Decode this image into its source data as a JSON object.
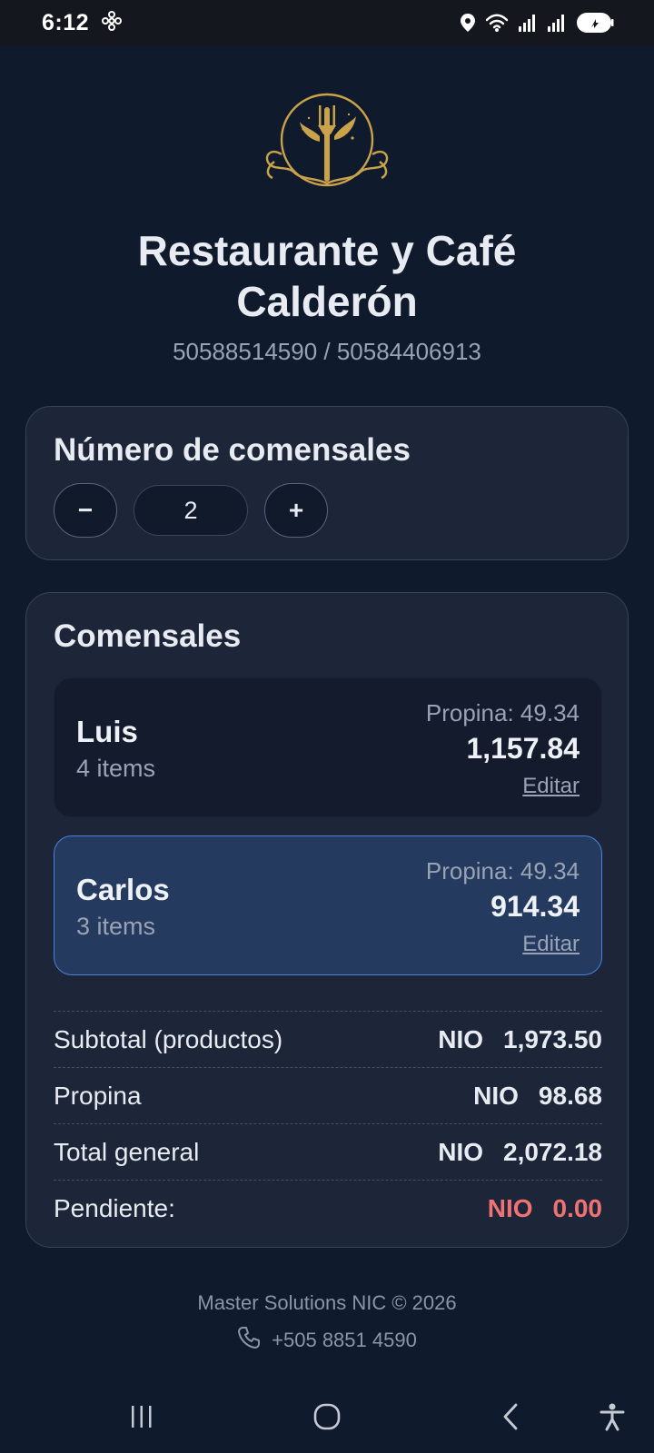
{
  "status_bar": {
    "time": "6:12",
    "icons": [
      "fan-icon",
      "location-icon",
      "wifi-icon",
      "signal-icon",
      "signal-icon-2",
      "battery-icon"
    ]
  },
  "header": {
    "logo": "restaurant-fork-leaf-logo",
    "title": "Restaurante y Café Calderón",
    "phones": "50588514590 / 50584406913"
  },
  "diners_count": {
    "title": "Número de comensales",
    "minus_label": "−",
    "value": "2",
    "plus_label": "+"
  },
  "diners": {
    "title": "Comensales",
    "list": [
      {
        "name": "Luis",
        "items": "4 items",
        "tip": "Propina: 49.34",
        "total": "1,157.84",
        "edit": "Editar"
      },
      {
        "name": "Carlos",
        "items": "3 items",
        "tip": "Propina: 49.34",
        "total": "914.34",
        "edit": "Editar"
      }
    ]
  },
  "summary": {
    "subtotal_label": "Subtotal (productos)",
    "subtotal_currency": "NIO",
    "subtotal_value": "1,973.50",
    "tip_label": "Propina",
    "tip_currency": "NIO",
    "tip_value": "98.68",
    "total_label": "Total general",
    "total_currency": "NIO",
    "total_value": "2,072.18",
    "pending_label": "Pendiente:",
    "pending_currency": "NIO",
    "pending_value": "0.00"
  },
  "footer": {
    "brand": "Master Solutions NIC © 2026",
    "phone": "+505 8851 4590"
  },
  "colors": {
    "background": "#101a2d",
    "card": "#1c2638",
    "selected_card": "#243a5e",
    "selected_border": "#4a83d8",
    "pending": "#f07272",
    "logo_gold": "#c9a24a"
  },
  "nav_bar": {
    "icons": [
      "recents-icon",
      "home-icon",
      "back-icon",
      "accessibility-icon"
    ]
  }
}
